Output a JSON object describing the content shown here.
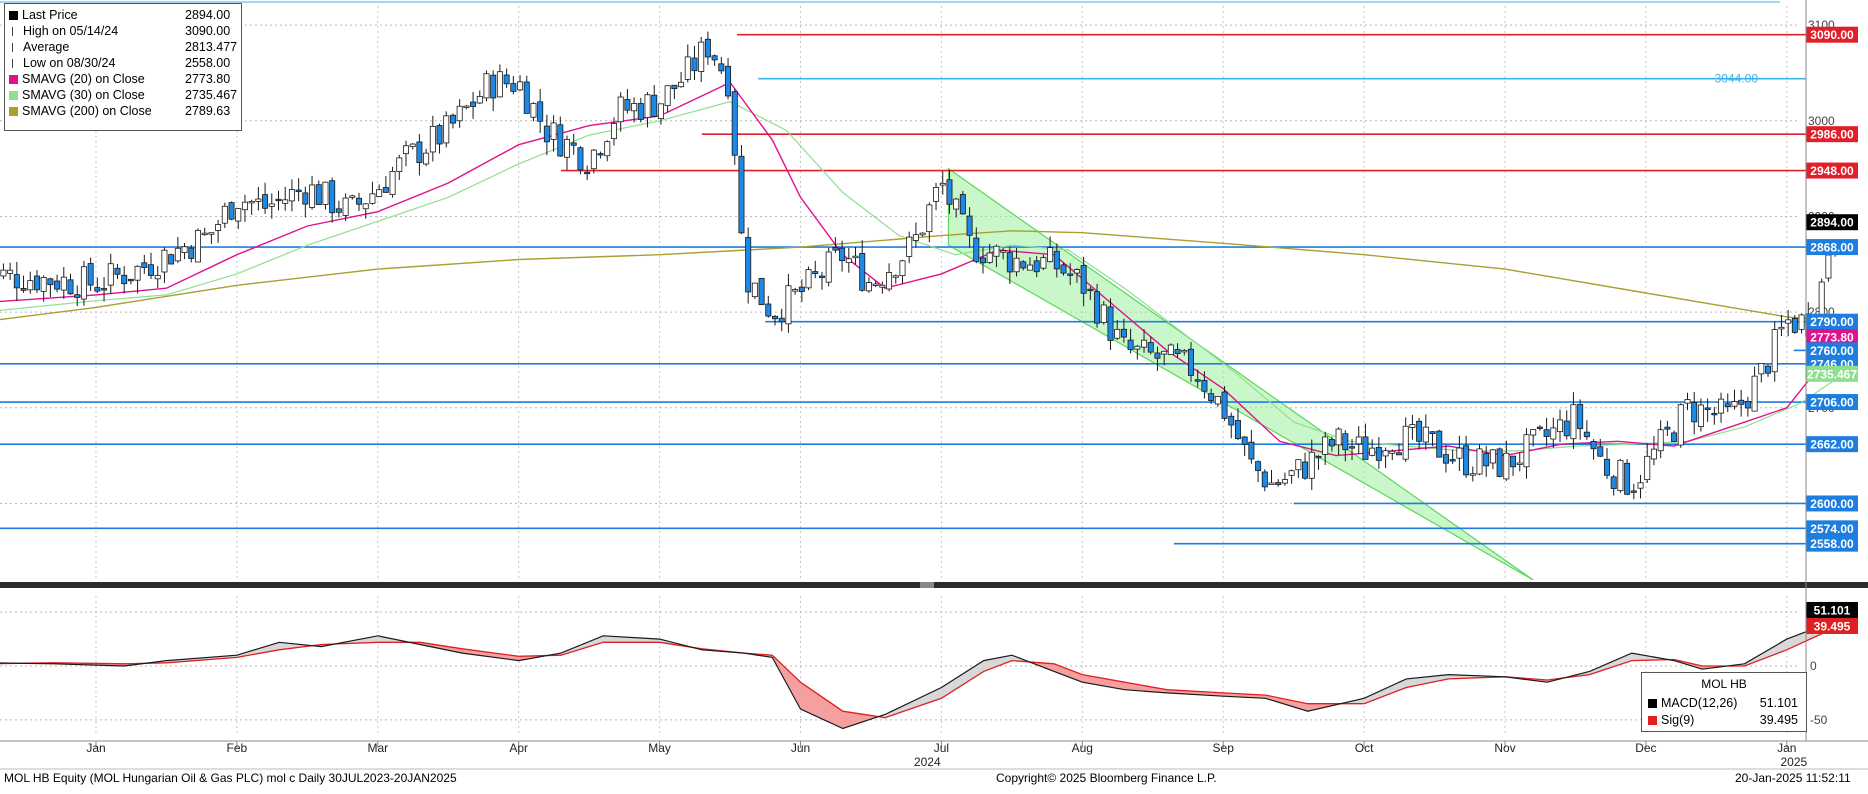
{
  "header": {
    "legend": [
      {
        "label": "Last Price",
        "value": "2894.00",
        "color": "#000000",
        "icon": "square-icon"
      },
      {
        "label": "High on 05/14/24",
        "value": "3090.00",
        "color": "#000000",
        "icon": "high-marker-icon"
      },
      {
        "label": "Average",
        "value": "2813.477",
        "color": "#000000",
        "icon": "average-marker-icon"
      },
      {
        "label": "Low on 08/30/24",
        "value": "2558.00",
        "color": "#000000",
        "icon": "low-marker-icon"
      },
      {
        "label": "SMAVG (20)  on Close",
        "value": "2773.80",
        "color": "#e0118f",
        "icon": "square-icon"
      },
      {
        "label": "SMAVG (30)  on Close",
        "value": "2735.467",
        "color": "#8ee08e",
        "icon": "square-icon"
      },
      {
        "label": "SMAVG (200)  on Close",
        "value": "2789.63",
        "color": "#a8a030",
        "icon": "square-icon"
      }
    ]
  },
  "macd_legend": {
    "title": "MOL HB",
    "rows": [
      {
        "label": "MACD(12,26)",
        "value": "51.101",
        "color": "#000000"
      },
      {
        "label": "Sig(9)",
        "value": "39.495",
        "color": "#e02020"
      }
    ]
  },
  "footer": {
    "left": "MOL HB Equity (MOL Hungarian Oil & Gas PLC) mol c  Daily 30JUL2023-20JAN2025",
    "center": "Copyright© 2025 Bloomberg Finance L.P.",
    "right": "20-Jan-2025 11:52:11"
  },
  "chart_data": {
    "type": "candlestick",
    "ylim": [
      2520,
      3120
    ],
    "yticks": [
      2600,
      2700,
      2800,
      2900,
      3000,
      3100
    ],
    "x_labels": [
      {
        "label": "Jan",
        "month": 0
      },
      {
        "label": "Feb",
        "month": 1
      },
      {
        "label": "Mar",
        "month": 2
      },
      {
        "label": "Apr",
        "month": 3
      },
      {
        "label": "May",
        "month": 4
      },
      {
        "label": "Jun",
        "month": 5
      },
      {
        "label": "Jul",
        "month": 6
      },
      {
        "label": "Aug",
        "month": 7
      },
      {
        "label": "Sep",
        "month": 8
      },
      {
        "label": "Oct",
        "month": 9
      },
      {
        "label": "Nov",
        "month": 10
      },
      {
        "label": "Dec",
        "month": 11
      },
      {
        "label": "Jan",
        "month": 12
      }
    ],
    "year_labels": [
      {
        "label": "2024",
        "month": 5.9
      },
      {
        "label": "2025",
        "month": 12.05
      }
    ],
    "price_path": [
      [
        -0.8,
        2840
      ],
      [
        -0.4,
        2835
      ],
      [
        0,
        2830
      ],
      [
        0.3,
        2845
      ],
      [
        0.5,
        2860
      ],
      [
        0.8,
        2880
      ],
      [
        1.0,
        2920
      ],
      [
        1.2,
        2910
      ],
      [
        1.5,
        2930
      ],
      [
        1.8,
        2905
      ],
      [
        2.0,
        2930
      ],
      [
        2.2,
        2960
      ],
      [
        2.5,
        2990
      ],
      [
        2.8,
        3040
      ],
      [
        3.0,
        3040
      ],
      [
        3.2,
        2990
      ],
      [
        3.5,
        2960
      ],
      [
        3.7,
        3010
      ],
      [
        4.0,
        3020
      ],
      [
        4.2,
        3050
      ],
      [
        4.35,
        3080
      ],
      [
        4.5,
        3040
      ],
      [
        4.6,
        2840
      ],
      [
        4.8,
        2800
      ],
      [
        5.0,
        2820
      ],
      [
        5.3,
        2860
      ],
      [
        5.5,
        2830
      ],
      [
        5.8,
        2870
      ],
      [
        6.0,
        2935
      ],
      [
        6.2,
        2870
      ],
      [
        6.5,
        2855
      ],
      [
        6.8,
        2850
      ],
      [
        7.0,
        2830
      ],
      [
        7.3,
        2760
      ],
      [
        7.6,
        2750
      ],
      [
        7.8,
        2740
      ],
      [
        8.0,
        2700
      ],
      [
        8.2,
        2640
      ],
      [
        8.35,
        2620
      ],
      [
        8.5,
        2630
      ],
      [
        8.8,
        2665
      ],
      [
        9.0,
        2655
      ],
      [
        9.2,
        2670
      ],
      [
        9.5,
        2660
      ],
      [
        9.7,
        2645
      ],
      [
        10.0,
        2640
      ],
      [
        10.2,
        2660
      ],
      [
        10.5,
        2690
      ],
      [
        10.7,
        2640
      ],
      [
        10.9,
        2620
      ],
      [
        11.0,
        2640
      ],
      [
        11.3,
        2700
      ],
      [
        11.6,
        2690
      ],
      [
        11.8,
        2730
      ],
      [
        12.0,
        2790
      ],
      [
        12.1,
        2790
      ],
      [
        12.2,
        2790
      ],
      [
        12.3,
        2870
      ],
      [
        12.4,
        2894
      ]
    ],
    "ma20": [
      [
        -0.8,
        2810
      ],
      [
        0,
        2818
      ],
      [
        0.5,
        2825
      ],
      [
        1.0,
        2860
      ],
      [
        1.5,
        2890
      ],
      [
        2.0,
        2905
      ],
      [
        2.5,
        2935
      ],
      [
        3.0,
        2975
      ],
      [
        3.5,
        2995
      ],
      [
        4.0,
        3005
      ],
      [
        4.5,
        3040
      ],
      [
        4.8,
        2980
      ],
      [
        5.0,
        2920
      ],
      [
        5.3,
        2860
      ],
      [
        5.6,
        2825
      ],
      [
        6.0,
        2840
      ],
      [
        6.4,
        2865
      ],
      [
        6.8,
        2860
      ],
      [
        7.2,
        2810
      ],
      [
        7.6,
        2760
      ],
      [
        8.0,
        2720
      ],
      [
        8.4,
        2665
      ],
      [
        8.8,
        2650
      ],
      [
        9.2,
        2655
      ],
      [
        9.6,
        2660
      ],
      [
        10.0,
        2650
      ],
      [
        10.4,
        2662
      ],
      [
        10.8,
        2665
      ],
      [
        11.2,
        2660
      ],
      [
        11.6,
        2680
      ],
      [
        12.0,
        2700
      ],
      [
        12.4,
        2774
      ]
    ],
    "ma30": [
      [
        -0.8,
        2800
      ],
      [
        0,
        2812
      ],
      [
        0.5,
        2818
      ],
      [
        1.0,
        2840
      ],
      [
        1.5,
        2870
      ],
      [
        2.0,
        2895
      ],
      [
        2.5,
        2920
      ],
      [
        3.0,
        2955
      ],
      [
        3.5,
        2985
      ],
      [
        4.0,
        3000
      ],
      [
        4.5,
        3020
      ],
      [
        4.9,
        2990
      ],
      [
        5.3,
        2925
      ],
      [
        5.7,
        2880
      ],
      [
        6.1,
        2860
      ],
      [
        6.5,
        2870
      ],
      [
        6.9,
        2865
      ],
      [
        7.3,
        2825
      ],
      [
        7.7,
        2780
      ],
      [
        8.1,
        2735
      ],
      [
        8.5,
        2685
      ],
      [
        8.9,
        2665
      ],
      [
        9.3,
        2660
      ],
      [
        9.7,
        2655
      ],
      [
        10.1,
        2655
      ],
      [
        10.5,
        2660
      ],
      [
        10.9,
        2662
      ],
      [
        11.3,
        2665
      ],
      [
        11.7,
        2680
      ],
      [
        12.1,
        2705
      ],
      [
        12.4,
        2735
      ]
    ],
    "ma200": [
      [
        -0.8,
        2790
      ],
      [
        0,
        2805
      ],
      [
        1.0,
        2828
      ],
      [
        2.0,
        2845
      ],
      [
        3.0,
        2855
      ],
      [
        4.0,
        2860
      ],
      [
        5.0,
        2868
      ],
      [
        6.0,
        2880
      ],
      [
        6.5,
        2885
      ],
      [
        7.0,
        2883
      ],
      [
        8.0,
        2872
      ],
      [
        9.0,
        2860
      ],
      [
        10.0,
        2845
      ],
      [
        11.0,
        2820
      ],
      [
        12.0,
        2795
      ],
      [
        12.4,
        2790
      ]
    ],
    "levels": [
      {
        "value": 3090.0,
        "label": "3090.00",
        "color": "#e01f2a",
        "x_start": 4.55,
        "badge": true
      },
      {
        "value": 3044.0,
        "label": "3044.00",
        "color": "#3ab4ea",
        "x_start": 4.7,
        "badge": false
      },
      {
        "value": 2986.0,
        "label": "2986.00",
        "color": "#e01f2a",
        "x_start": 4.3,
        "badge": true
      },
      {
        "value": 2948.0,
        "label": "2948.00",
        "color": "#e01f2a",
        "x_start": 3.3,
        "badge": true
      },
      {
        "value": 2894.0,
        "label": "2894.00",
        "color": "#000000",
        "x_start": -1,
        "badge": true
      },
      {
        "value": 2868.0,
        "label": "2868.00",
        "color": "#1e7ee0",
        "x_start": -1,
        "badge": true
      },
      {
        "value": 2790.0,
        "label": "2790.00",
        "color": "#1e7ee0",
        "x_start": 4.75,
        "badge": true
      },
      {
        "value": 2773.8,
        "label": "2773.80",
        "color": "#e0118f",
        "x_start": 99,
        "badge": true
      },
      {
        "value": 2760.0,
        "label": "2760.00",
        "color": "#1e7ee0",
        "x_start": 12.05,
        "badge": true
      },
      {
        "value": 2746.0,
        "label": "2746.00",
        "color": "#1e7ee0",
        "x_start": -1,
        "badge": true
      },
      {
        "value": 2735.467,
        "label": "2735.467",
        "color": "#8ee08e",
        "x_start": 99,
        "badge": true
      },
      {
        "value": 2706.0,
        "label": "2706.00",
        "color": "#1e7ee0",
        "x_start": -1,
        "badge": true
      },
      {
        "value": 2662.0,
        "label": "2662.00",
        "color": "#1e7ee0",
        "x_start": -1,
        "badge": true
      },
      {
        "value": 2600.0,
        "label": "2600.00",
        "color": "#1e7ee0",
        "x_start": 8.5,
        "badge": true
      },
      {
        "value": 2574.0,
        "label": "2574.00",
        "color": "#1e7ee0",
        "x_start": -1,
        "badge": true
      },
      {
        "value": 2558.0,
        "label": "2558.00",
        "color": "#1e7ee0",
        "x_start": 7.65,
        "badge": true
      }
    ],
    "channel": {
      "upper": [
        [
          6.05,
          2950
        ],
        [
          10.2,
          2520
        ]
      ],
      "lower": [
        [
          6.05,
          2870
        ],
        [
          10.2,
          2400
        ]
      ],
      "color": "#9ef09e"
    },
    "macd": {
      "ylim": [
        -65,
        65
      ],
      "yticks": [
        -50,
        0,
        50
      ],
      "macd_label_value": "51.101",
      "signal_label_value": "39.495",
      "macd_line": [
        [
          -0.8,
          3
        ],
        [
          -0.3,
          2
        ],
        [
          0.2,
          0
        ],
        [
          0.5,
          5
        ],
        [
          1.0,
          10
        ],
        [
          1.3,
          22
        ],
        [
          1.6,
          18
        ],
        [
          2.0,
          28
        ],
        [
          2.3,
          20
        ],
        [
          2.6,
          12
        ],
        [
          3.0,
          5
        ],
        [
          3.3,
          12
        ],
        [
          3.6,
          28
        ],
        [
          4.0,
          25
        ],
        [
          4.3,
          15
        ],
        [
          4.6,
          12
        ],
        [
          4.8,
          8
        ],
        [
          5.0,
          -40
        ],
        [
          5.3,
          -58
        ],
        [
          5.6,
          -45
        ],
        [
          6.0,
          -20
        ],
        [
          6.3,
          5
        ],
        [
          6.5,
          10
        ],
        [
          6.8,
          -5
        ],
        [
          7.0,
          -15
        ],
        [
          7.3,
          -22
        ],
        [
          7.6,
          -25
        ],
        [
          8.0,
          -28
        ],
        [
          8.3,
          -30
        ],
        [
          8.6,
          -42
        ],
        [
          9.0,
          -30
        ],
        [
          9.3,
          -12
        ],
        [
          9.6,
          -8
        ],
        [
          10.0,
          -10
        ],
        [
          10.3,
          -15
        ],
        [
          10.6,
          -5
        ],
        [
          10.9,
          12
        ],
        [
          11.2,
          5
        ],
        [
          11.4,
          -3
        ],
        [
          11.7,
          2
        ],
        [
          12.0,
          25
        ],
        [
          12.2,
          35
        ],
        [
          12.4,
          51
        ]
      ],
      "signal_line": [
        [
          -0.8,
          2
        ],
        [
          -0.3,
          3
        ],
        [
          0.2,
          2
        ],
        [
          0.5,
          3
        ],
        [
          1.0,
          8
        ],
        [
          1.3,
          15
        ],
        [
          1.6,
          20
        ],
        [
          2.0,
          22
        ],
        [
          2.3,
          22
        ],
        [
          2.6,
          16
        ],
        [
          3.0,
          9
        ],
        [
          3.3,
          10
        ],
        [
          3.6,
          22
        ],
        [
          4.0,
          22
        ],
        [
          4.3,
          16
        ],
        [
          4.6,
          12
        ],
        [
          4.8,
          10
        ],
        [
          5.0,
          -15
        ],
        [
          5.3,
          -42
        ],
        [
          5.6,
          -48
        ],
        [
          6.0,
          -30
        ],
        [
          6.3,
          -5
        ],
        [
          6.5,
          5
        ],
        [
          6.8,
          2
        ],
        [
          7.0,
          -8
        ],
        [
          7.3,
          -15
        ],
        [
          7.6,
          -22
        ],
        [
          8.0,
          -25
        ],
        [
          8.3,
          -27
        ],
        [
          8.6,
          -35
        ],
        [
          9.0,
          -35
        ],
        [
          9.3,
          -20
        ],
        [
          9.6,
          -12
        ],
        [
          10.0,
          -10
        ],
        [
          10.3,
          -13
        ],
        [
          10.6,
          -8
        ],
        [
          10.9,
          5
        ],
        [
          11.2,
          6
        ],
        [
          11.4,
          0
        ],
        [
          11.7,
          0
        ],
        [
          12.0,
          15
        ],
        [
          12.2,
          27
        ],
        [
          12.4,
          39
        ]
      ]
    }
  }
}
